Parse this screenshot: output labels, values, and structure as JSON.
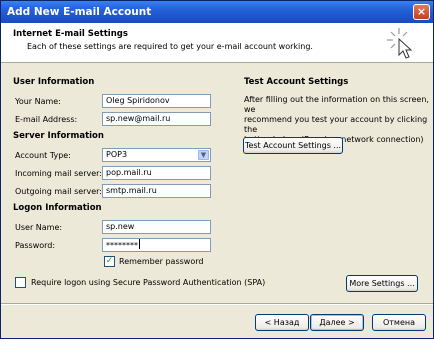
{
  "window": {
    "title": "Add New E-mail Account",
    "close_glyph": "×"
  },
  "header": {
    "title": "Internet E-mail Settings",
    "subtitle": "Each of these settings are required to get your e-mail account working.",
    "icon": "wizard-cursor-icon"
  },
  "user_info": {
    "heading": "User Information",
    "name_label": "Your Name:",
    "name_value": "Oleg Spiridonov",
    "email_label": "E-mail Address:",
    "email_value": "sp.new@mail.ru"
  },
  "server_info": {
    "heading": "Server Information",
    "account_type_label": "Account Type:",
    "account_type_value": "POP3",
    "incoming_label": "Incoming mail server:",
    "incoming_value": "pop.mail.ru",
    "outgoing_label": "Outgoing mail server:",
    "outgoing_value": "smtp.mail.ru"
  },
  "logon_info": {
    "heading": "Logon Information",
    "username_label": "User Name:",
    "username_value": "sp.new",
    "password_label": "Password:",
    "password_value": "********",
    "remember_label": "Remember password",
    "remember_checked": true
  },
  "spa": {
    "label": "Require logon using Secure Password Authentication (SPA)",
    "checked": false
  },
  "test": {
    "heading": "Test Account Settings",
    "description_lines": [
      "After filling out the information on this screen, we",
      "recommend you test your account by clicking the",
      "button below. (Requires network connection)"
    ],
    "button_label": "Test Account Settings ..."
  },
  "more_settings_label": "More Settings ...",
  "footer": {
    "back_label": "< Назад",
    "next_label": "Далее >",
    "cancel_label": "Отмена"
  },
  "colors": {
    "title_bar": "#2563da",
    "dialog_bg": "#ece9d8",
    "input_border": "#7f9db9",
    "button_border": "#003c74"
  }
}
